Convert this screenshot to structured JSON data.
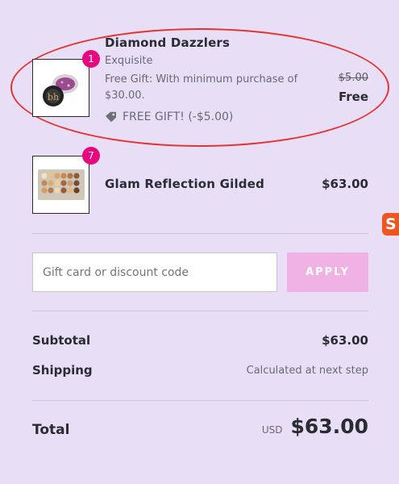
{
  "items": [
    {
      "name": "Diamond Dazzlers",
      "variant": "Exquisite",
      "note": "Free Gift: With minimum purchase of $30.00.",
      "original_price": "$5.00",
      "price": "Free",
      "discount": "FREE GIFT! (-$5.00)",
      "quantity": "1"
    },
    {
      "name": "Glam Reflection Gilded",
      "price": "$63.00",
      "quantity": "7"
    }
  ],
  "discount_form": {
    "placeholder": "Gift card or discount code",
    "apply_label": "APPLY"
  },
  "summary": {
    "subtotal_label": "Subtotal",
    "subtotal_value": "$63.00",
    "shipping_label": "Shipping",
    "shipping_value": "Calculated at next step",
    "total_label": "Total",
    "currency": "USD",
    "total_value": "$63.00"
  },
  "colors": {
    "background": "#e8def5",
    "badge": "#e5087e",
    "apply_button": "#f0b2e4",
    "annotation": "#e53434"
  },
  "icons": [
    "tag-icon",
    "side-logo-icon"
  ]
}
